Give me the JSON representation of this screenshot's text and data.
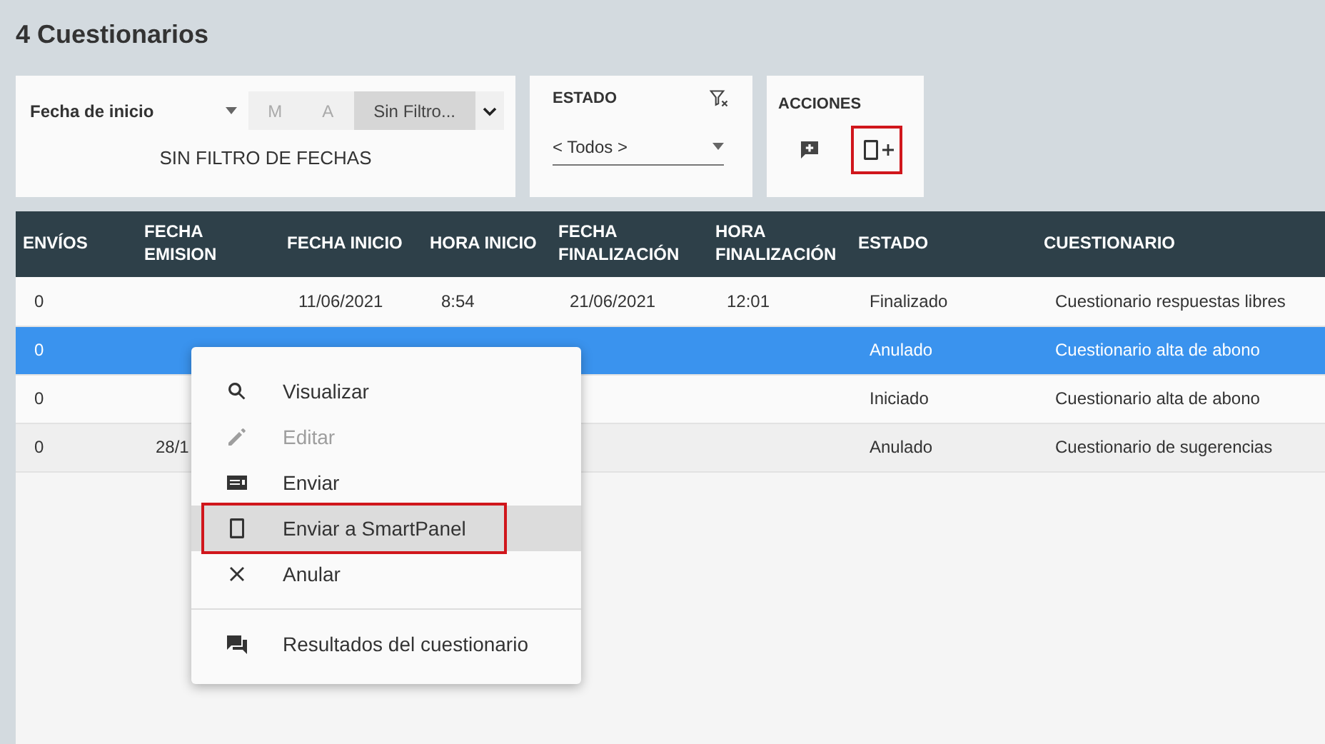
{
  "page_title": "4 Cuestionarios",
  "date_filter": {
    "field": "Fecha de inicio",
    "segments": [
      {
        "label": "M",
        "selected": false
      },
      {
        "label": "A",
        "selected": false
      },
      {
        "label": "Sin Filtro...",
        "selected": true
      }
    ],
    "summary": "SIN FILTRO DE FECHAS"
  },
  "status_filter": {
    "title": "ESTADO",
    "value": "< Todos >"
  },
  "actions": {
    "title": "ACCIONES",
    "buttons": [
      {
        "kind": "comment",
        "highlighted": false
      },
      {
        "kind": "tablet",
        "highlighted": true
      }
    ]
  },
  "table": {
    "columns": [
      "ENVÍOS",
      "FECHA\nEMISION",
      "FECHA INICIO",
      "HORA INICIO",
      "FECHA\nFINALIZACIÓN",
      "HORA\nFINALIZACIÓN",
      "ESTADO",
      "CUESTIONARIO"
    ],
    "rows": [
      {
        "cells": [
          "0",
          "",
          "11/06/2021",
          "8:54",
          "21/06/2021",
          "12:01",
          "Finalizado",
          "Cuestionario respuestas libres"
        ],
        "selected": false
      },
      {
        "cells": [
          "0",
          "",
          "",
          "",
          "",
          "",
          "Anulado",
          "Cuestionario alta de abono"
        ],
        "selected": true
      },
      {
        "cells": [
          "0",
          "",
          "",
          "",
          "",
          "",
          "Iniciado",
          "Cuestionario alta de abono"
        ],
        "selected": false
      },
      {
        "cells": [
          "0",
          "28/1",
          "",
          "",
          "",
          "",
          "Anulado",
          "Cuestionario de sugerencias"
        ],
        "selected": false
      }
    ]
  },
  "context_menu": [
    {
      "kind": "search",
      "label": "Visualizar",
      "disabled": false,
      "highlighted": false
    },
    {
      "kind": "edit",
      "label": "Editar",
      "disabled": true,
      "highlighted": false
    },
    {
      "kind": "send",
      "label": "Enviar",
      "disabled": false,
      "highlighted": false
    },
    {
      "kind": "tablet",
      "label": "Enviar a SmartPanel",
      "disabled": false,
      "highlighted": true
    },
    {
      "kind": "close",
      "label": "Anular",
      "disabled": false,
      "highlighted": false
    },
    {
      "kind": "divider"
    },
    {
      "kind": "results",
      "label": "Resultados del cuestionario",
      "disabled": false,
      "highlighted": false
    }
  ]
}
